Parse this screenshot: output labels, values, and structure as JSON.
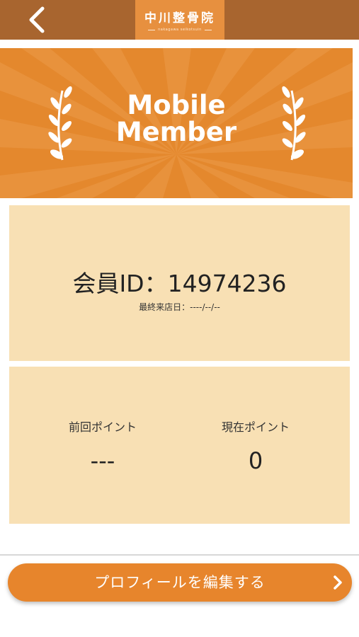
{
  "header": {
    "back_icon": "chevron-left-icon",
    "logo_title": "中川整骨院",
    "logo_subtitle": "nakagawa seikotsuin"
  },
  "banner": {
    "title_line1": "Mobile",
    "title_line2": "Member",
    "left_icon": "laurel-icon",
    "right_icon": "laurel-icon"
  },
  "member": {
    "id_text": "会員ID：14974236",
    "last_visit": "最終来店日：----/--/--"
  },
  "points": {
    "previous_label": "前回ポイント",
    "previous_value": "---",
    "current_label": "現在ポイント",
    "current_value": "0"
  },
  "actions": {
    "edit_profile_label": "プロフィールを編集する",
    "edit_profile_icon": "chevron-right-icon"
  },
  "colors": {
    "header": "#a8652f",
    "logo": "#e7903f",
    "banner": "#e4882d",
    "card": "#f8e0b4",
    "button": "#e7852c"
  }
}
